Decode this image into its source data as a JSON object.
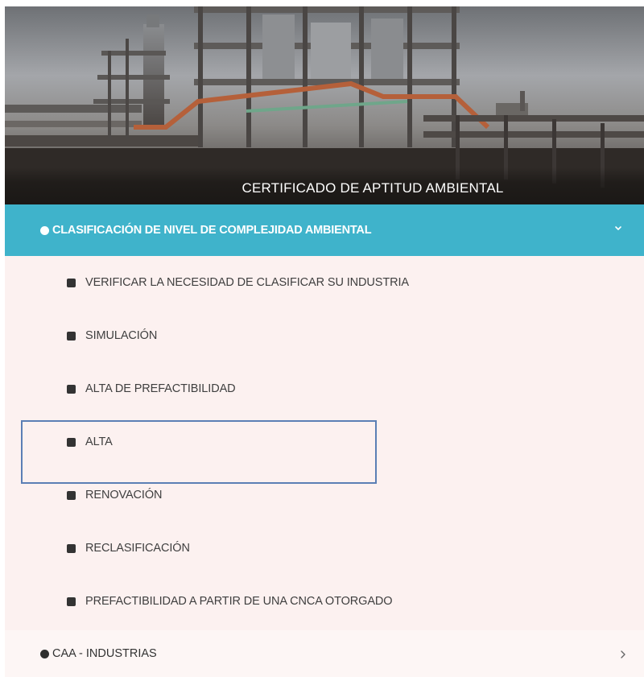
{
  "hero": {
    "title": "CERTIFICADO DE APTITUD AMBIENTAL",
    "image": "industrial-plant-photo"
  },
  "section": {
    "title": "CLASIFICACIÓN DE NIVEL DE COMPLEJIDAD AMBIENTAL",
    "expanded": true,
    "accent_color": "#3fb3cb",
    "icon": "chevron-down-icon"
  },
  "submenu": [
    {
      "label": "VERIFICAR LA NECESIDAD DE CLASIFICAR SU INDUSTRIA"
    },
    {
      "label": "SIMULACIÓN"
    },
    {
      "label": "ALTA DE PREFACTIBILIDAD"
    },
    {
      "label": "ALTA",
      "highlighted": true
    },
    {
      "label": "RENOVACIÓN"
    },
    {
      "label": "RECLASIFICACIÓN"
    },
    {
      "label": "PREFACTIBILIDAD A PARTIR DE UNA CNCA OTORGADO"
    }
  ],
  "footer_item": {
    "label": "CAA - INDUSTRIAS",
    "icon": "chevron-right-icon"
  },
  "colors": {
    "panel_background": "#fcf1f0",
    "highlight_border": "#5b7fb5"
  }
}
